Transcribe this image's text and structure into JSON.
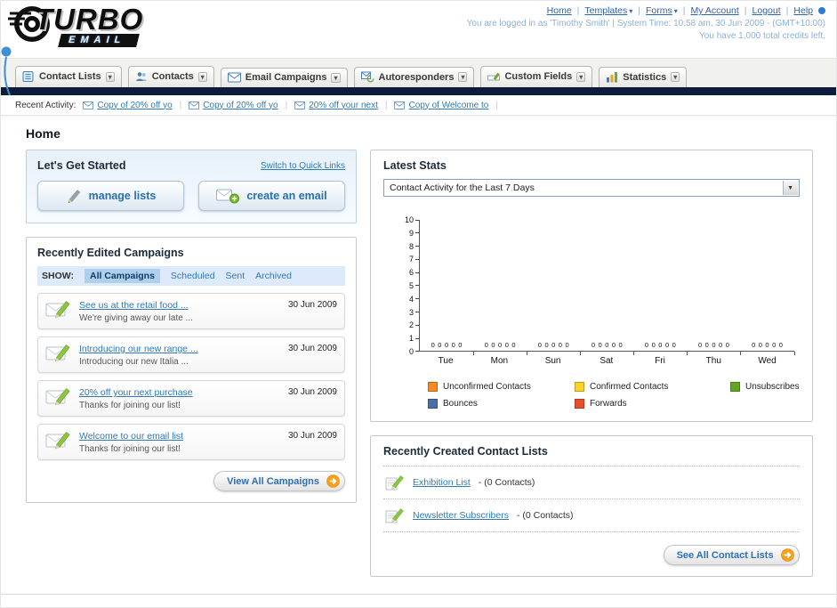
{
  "colors": {
    "link_blue": "#2F7AB8",
    "dark_nav_bar": "#0D1C3A",
    "accent_orange": "#F7A01B",
    "panel_border": "#C9C9C9",
    "tab_bg": "#F1F1EE"
  },
  "header": {
    "logo_title": "TURBO",
    "logo_subtitle": "EMAIL",
    "nav_links": [
      {
        "label": "Home",
        "dropdown": false
      },
      {
        "label": "Templates",
        "dropdown": true
      },
      {
        "label": "Forms",
        "dropdown": true
      },
      {
        "label": "My Account",
        "dropdown": false
      },
      {
        "label": "Logout",
        "dropdown": false
      },
      {
        "label": "Help",
        "dropdown": false
      }
    ],
    "login_text": "You are logged in as 'Timothy Smith' | System Time: 10:58 am, 30 Jun 2009 - (GMT+10:00)",
    "credits_text": "You have 1,000 total credits left."
  },
  "nav_tabs": [
    {
      "label": "Contact Lists",
      "icon": "contact-lists-icon"
    },
    {
      "label": "Contacts",
      "icon": "contacts-icon"
    },
    {
      "label": "Email Campaigns",
      "icon": "email-campaigns-icon"
    },
    {
      "label": "Autoresponders",
      "icon": "autoresponders-icon"
    },
    {
      "label": "Custom Fields",
      "icon": "custom-fields-icon"
    },
    {
      "label": "Statistics",
      "icon": "statistics-icon"
    }
  ],
  "recent_activity": {
    "label": "Recent Activity:",
    "items": [
      {
        "label": "Copy of 20% off yo"
      },
      {
        "label": "Copy of 20% off yo"
      },
      {
        "label": "20% off your next"
      },
      {
        "label": "Copy of Welcome to"
      }
    ]
  },
  "page_title": "Home",
  "get_started": {
    "title": "Let's Get Started",
    "switch_link": "Switch to Quick Links",
    "manage_lists_label": "manage lists",
    "create_email_label": "create an email"
  },
  "campaigns": {
    "title": "Recently Edited Campaigns",
    "show_label": "SHOW:",
    "filters": [
      {
        "label": "All Campaigns",
        "selected": true
      },
      {
        "label": "Scheduled",
        "selected": false
      },
      {
        "label": "Sent",
        "selected": false
      },
      {
        "label": "Archived",
        "selected": false
      }
    ],
    "items": [
      {
        "title": "See us at the retail food ...",
        "subtitle": "We're giving away our late ...",
        "date": "30 Jun 2009"
      },
      {
        "title": "Introducing our new range ...",
        "subtitle": "Introducing our new Italia ...",
        "date": "30 Jun 2009"
      },
      {
        "title": "20% off your next purchase",
        "subtitle": "Thanks for joining our list!",
        "date": "30 Jun 2009"
      },
      {
        "title": "Welcome to our email list",
        "subtitle": "Thanks for joining our list!",
        "date": "30 Jun 2009"
      }
    ],
    "view_all_label": "View All Campaigns"
  },
  "stats": {
    "title": "Latest Stats",
    "dropdown_value": "Contact Activity for the Last 7 Days",
    "legend": [
      {
        "label": "Unconfirmed Contacts",
        "color": "#F6891F"
      },
      {
        "label": "Confirmed Contacts",
        "color": "#FFD226"
      },
      {
        "label": "Unsubscribes",
        "color": "#62A51E"
      },
      {
        "label": "Bounces",
        "color": "#4A6EA9"
      },
      {
        "label": "Forwards",
        "color": "#E8502D"
      }
    ]
  },
  "chart_data": {
    "type": "bar",
    "title": "Contact Activity for the Last 7 Days",
    "categories": [
      "Tue",
      "Mon",
      "Sun",
      "Sat",
      "Fri",
      "Thu",
      "Wed"
    ],
    "series": [
      {
        "name": "Unconfirmed Contacts",
        "color": "#F6891F",
        "values": [
          0,
          0,
          0,
          0,
          0,
          0,
          0
        ]
      },
      {
        "name": "Confirmed Contacts",
        "color": "#FFD226",
        "values": [
          0,
          0,
          0,
          0,
          0,
          0,
          0
        ]
      },
      {
        "name": "Unsubscribes",
        "color": "#62A51E",
        "values": [
          0,
          0,
          0,
          0,
          0,
          0,
          0
        ]
      },
      {
        "name": "Bounces",
        "color": "#4A6EA9",
        "values": [
          0,
          0,
          0,
          0,
          0,
          0,
          0
        ]
      },
      {
        "name": "Forwards",
        "color": "#E8502D",
        "values": [
          0,
          0,
          0,
          0,
          0,
          0,
          0
        ]
      }
    ],
    "xlabel": "",
    "ylabel": "",
    "ylim": [
      0,
      10
    ],
    "yticks": [
      0,
      1,
      2,
      3,
      4,
      5,
      6,
      7,
      8,
      9,
      10
    ],
    "grid": false,
    "legend_position": "bottom",
    "value_labels_shown": true
  },
  "contact_lists": {
    "title": "Recently Created Contact Lists",
    "items": [
      {
        "name": "Exhibition List",
        "suffix": " - (0 Contacts)"
      },
      {
        "name": "Newsletter Subscribers",
        "suffix": " - (0 Contacts)"
      }
    ],
    "see_all_label": "See All Contact Lists"
  }
}
